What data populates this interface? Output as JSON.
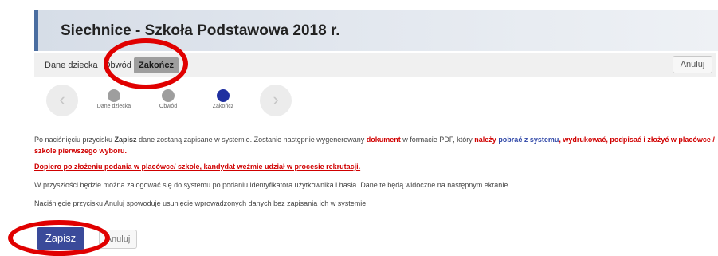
{
  "header": {
    "title": "Siechnice - Szkoła Podstawowa 2018 r."
  },
  "tabs": [
    {
      "label": "Dane dziecka"
    },
    {
      "label": "Obwód"
    },
    {
      "label": "Zakończ"
    }
  ],
  "toolbar": {
    "cancel_label": "Anuluj"
  },
  "stepper": {
    "prev_glyph": "‹",
    "next_glyph": "›",
    "steps": [
      {
        "label": "Dane dziecka",
        "color": "#9e9e9e"
      },
      {
        "label": "Obwód",
        "color": "#9e9e9e"
      },
      {
        "label": "Zakończ",
        "color": "#1f2fa0"
      }
    ]
  },
  "content": {
    "p1_a": "Po naciśnięciu przycisku ",
    "p1_b": "Zapisz",
    "p1_c": " dane zostaną zapisane w systemie. Zostanie następnie wygenerowany ",
    "p1_d": "dokument",
    "p1_e": " w formacie PDF, który ",
    "p1_f": "należy",
    "p1_g": " ",
    "p1_h": "pobrać z systemu",
    "p1_i": ", wydrukować, podpisać i złożyć w placówce / szkole pierwszego wyboru.",
    "p2": "Dopiero po złożeniu podania w placówce/ szkole, kandydat weźmie udział w procesie rekrutacji.",
    "p3": "W przyszłości będzie można zalogować się do systemu po podaniu identyfikatora użytkownika i hasła. Dane te będą widoczne na następnym ekranie.",
    "p4": "Naciśnięcie przycisku Anuluj spowoduje usunięcie wprowadzonych danych bez zapisania ich w systemie."
  },
  "actions": {
    "save_label": "Zapisz",
    "cancel_label": "Anuluj"
  },
  "colors": {
    "accent": "#3a4a9a",
    "annotation": "#e00000",
    "warning": "#d00000"
  }
}
